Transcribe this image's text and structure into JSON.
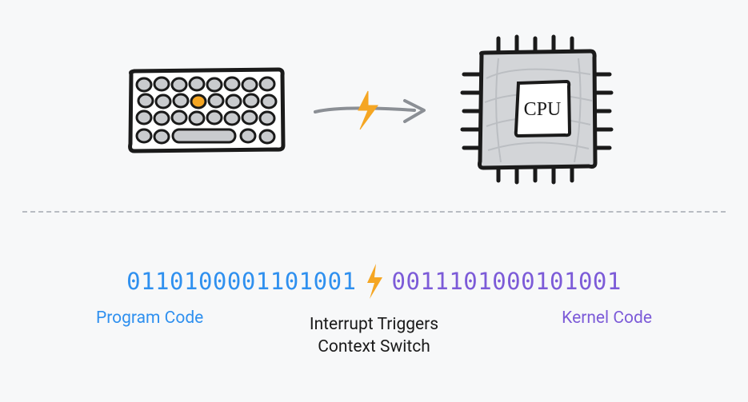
{
  "diagram": {
    "cpu_label": "CPU",
    "binary": {
      "program": "0110100001101001",
      "kernel": "0011101000101001"
    },
    "labels": {
      "program": "Program Code",
      "kernel": "Kernel Code",
      "interrupt_line1": "Interrupt Triggers",
      "interrupt_line2": "Context Switch"
    },
    "colors": {
      "program": "#2f90ef",
      "kernel": "#7c5bd8",
      "bolt": "#f5a623",
      "ink": "#1a1a1a",
      "bg": "#f7f8f9"
    }
  }
}
